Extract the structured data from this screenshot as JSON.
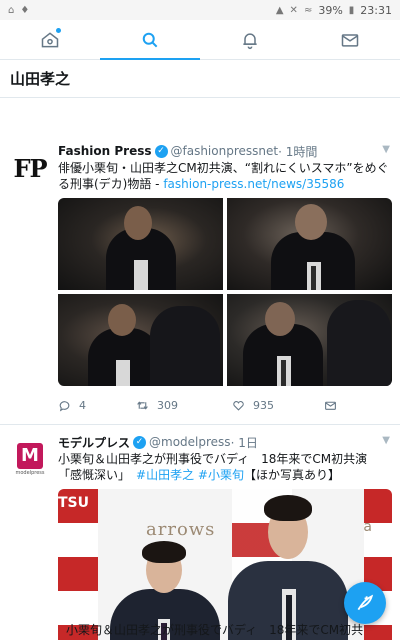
{
  "status_bar": {
    "battery": "39%",
    "time": "23:31",
    "left_icons": [
      "home-icon",
      "twitter-icon"
    ],
    "right_icons": [
      "signal-icon",
      "mute-icon",
      "wifi-icon",
      "battery-icon"
    ]
  },
  "tabs": [
    {
      "name": "home",
      "icon": "home-icon",
      "active": false
    },
    {
      "name": "search",
      "icon": "search-icon",
      "active": true
    },
    {
      "name": "notifications",
      "icon": "bell-icon",
      "active": false
    },
    {
      "name": "messages",
      "icon": "mail-icon",
      "active": false
    }
  ],
  "search": {
    "query": "山田孝之"
  },
  "tweets": [
    {
      "avatar_text": "FP",
      "name": "Fashion Press",
      "handle": "@fashionpressnet",
      "time": "· 1時間",
      "text": "俳優小栗旬・山田孝之CM初共演、“割れにくいスマホ”をめぐる刑事(デカ)物語 - ",
      "link": "fashion-press.net/news/35586",
      "replies": "4",
      "retweets": "309",
      "likes": "935"
    },
    {
      "avatar_text": "M",
      "avatar_sub": "modelpress",
      "name": "モデルプレス",
      "handle": "@modelpress",
      "time": "· 1日",
      "text_line1": "小栗旬＆山田孝之が刑事役でバディ　18年来でCM初共演",
      "text_line2_start": "「感慨深い」　",
      "hashtags": "#山田孝之 #小栗旬",
      "text_line2_end": "【ほか写真あり】",
      "brand_left": "TSU",
      "brand_center": "arrows",
      "brand_right": "a"
    }
  ],
  "caption": "小栗旬＆山田孝之が刑事役でバディ　18年来でCM初共",
  "colors": {
    "accent": "#1da1f2",
    "text": "#14171a",
    "muted": "#657786"
  }
}
